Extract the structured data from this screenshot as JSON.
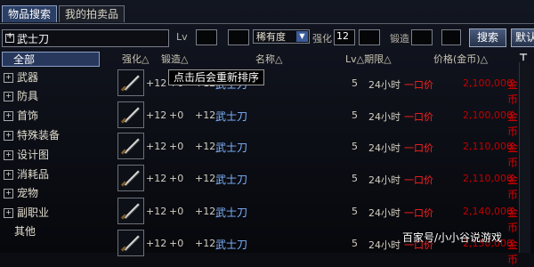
{
  "tabs": [
    "物品搜索",
    "我的拍卖品"
  ],
  "search": {
    "name_value": "武士刀",
    "lv_label": "Lv",
    "rarity_value": "稀有度",
    "enhance_label": "强化",
    "enhance_value": "12",
    "forge_label": "锻造",
    "search_button": "搜索",
    "default_button": "默认"
  },
  "categories": [
    "全部",
    "武器",
    "防具",
    "首饰",
    "特殊装备",
    "设计图",
    "消耗品",
    "宠物",
    "副职业",
    "其他"
  ],
  "headers": {
    "enhance": "强化△",
    "forge": "锻造△",
    "name": "名称△",
    "lv_period": "Lv△期限△",
    "price": "价格(金币)△"
  },
  "tooltip": "点击后会重新排序",
  "rows": [
    {
      "enhance": "+12",
      "forge": "+0",
      "amp": "+12",
      "name": "武士刀",
      "lv": "5",
      "period": "24小时",
      "buyout": "一口价",
      "price": "2,100,000",
      "unit": "金币"
    },
    {
      "enhance": "+12",
      "forge": "+0",
      "amp": "+12",
      "name": "武士刀",
      "lv": "5",
      "period": "24小时",
      "buyout": "一口价",
      "price": "2,100,000",
      "unit": "金币"
    },
    {
      "enhance": "+12",
      "forge": "+0",
      "amp": "+12",
      "name": "武士刀",
      "lv": "5",
      "period": "24小时",
      "buyout": "一口价",
      "price": "2,110,000",
      "unit": "金币"
    },
    {
      "enhance": "+12",
      "forge": "+0",
      "amp": "+12",
      "name": "武士刀",
      "lv": "5",
      "period": "24小时",
      "buyout": "一口价",
      "price": "2,110,000",
      "unit": "金币"
    },
    {
      "enhance": "+12",
      "forge": "+0",
      "amp": "+12",
      "name": "武士刀",
      "lv": "5",
      "period": "24小时",
      "buyout": "一口价",
      "price": "2,140,000",
      "unit": "金币"
    },
    {
      "enhance": "+12",
      "forge": "+0",
      "amp": "+12",
      "name": "武士刀",
      "lv": "5",
      "period": "24小时",
      "buyout": "一口价",
      "price": "2,150,000",
      "unit": "金币"
    }
  ],
  "watermark": "百家号/小小谷说游戏"
}
